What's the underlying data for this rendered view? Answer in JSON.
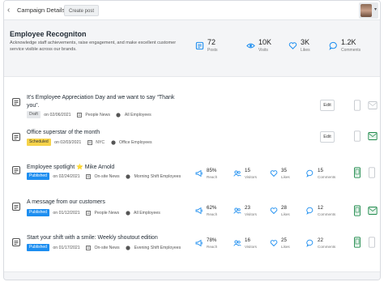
{
  "header": {
    "breadcrumb": "Campaign Details",
    "create_post_label": "Create post"
  },
  "campaign": {
    "title": "Employee Recogniton",
    "description": "Acknowledge staff achievements, raise engagement, and make excellent customer service visible across our brands.",
    "stats": [
      {
        "value": "72",
        "label": "Posts",
        "icon": "posts-icon"
      },
      {
        "value": "10K",
        "label": "Visits",
        "icon": "eye-icon"
      },
      {
        "value": "3K",
        "label": "Likes",
        "icon": "heart-icon"
      },
      {
        "value": "1.2K",
        "label": "Comments",
        "icon": "comment-icon"
      }
    ]
  },
  "posts": [
    {
      "title": "It’s Employee Appreciation Day and we want to say “Thank you”.",
      "status": "Draft",
      "date": "on 02/06/2021",
      "channel": "People News",
      "audience": "All Employees",
      "action": "Edit"
    },
    {
      "title": "Office superstar of the month",
      "status": "Scheduled",
      "date": "on 02/03/2021",
      "channel": "NYC",
      "audience": "Office Employees",
      "action": "Edit"
    },
    {
      "title": "Employee spotlight ⭐ Mike Arnold",
      "status": "Published",
      "date": "on 02/24/2021",
      "channel": "On-site News",
      "audience": "Morning Shift Employees",
      "reach": "85%",
      "visitors": "15",
      "likes": "35",
      "comments": "15"
    },
    {
      "title": "A message from our customers",
      "status": "Published",
      "date": "on 01/12/2021",
      "channel": "People News",
      "audience": "All Employees",
      "reach": "62%",
      "visitors": "23",
      "likes": "28",
      "comments": "12"
    },
    {
      "title": "Start your shift with a smile: Weekly shoutout edition",
      "status": "Published",
      "date": "on 01/17/2021",
      "channel": "On-site News",
      "audience": "Evening Shift Employees",
      "reach": "78%",
      "visitors": "16",
      "likes": "25",
      "comments": "22"
    }
  ],
  "labels": {
    "reach": "Reach",
    "visitors": "Visitors",
    "likes": "Likes",
    "comments": "Comments"
  },
  "colors": {
    "accent": "#1d8ef0",
    "published": "#1d8ef0",
    "scheduled": "#f6d34a",
    "draft": "#e5e7ea",
    "device_active": "#1f8a4c"
  }
}
